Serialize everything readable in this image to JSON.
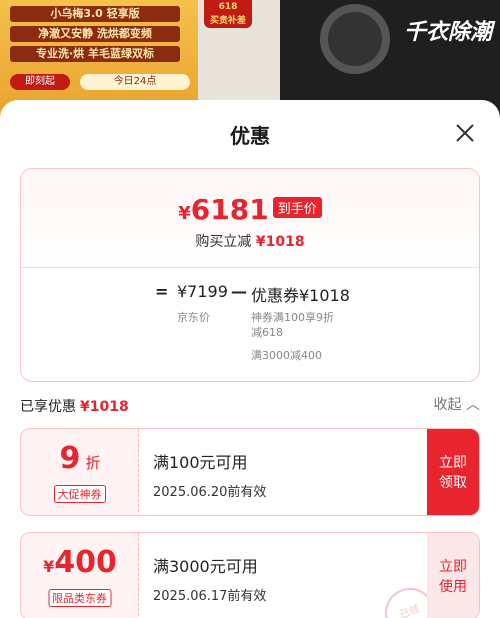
{
  "banner": {
    "lines": [
      "小乌梅3.0 轻享版",
      "净澈又安静 洗烘都变频",
      "专业洗·烘 羊毛蓝绿双标"
    ],
    "pill_left": "即刻起",
    "pill_right": "今日24点",
    "mid_tag": [
      "618",
      "买贵补差"
    ],
    "right_text": "千衣除潮"
  },
  "sheet": {
    "title": "优惠"
  },
  "summary": {
    "currency": "¥",
    "final_price": "6181",
    "price_tag": "到手价",
    "save_label": "购买立减",
    "save_amount": "¥1018",
    "eq": "=",
    "jd_price": "¥7199",
    "minus": "—",
    "coupon_total": "优惠券¥1018",
    "jd_price_label": "京东价",
    "coupon_detail_1": "神券满100享9折",
    "coupon_detail_2": "减618",
    "coupon_detail_3": "满3000减400"
  },
  "received": {
    "label": "已享优惠",
    "amount": "¥1018",
    "collapse": "收起 ︿"
  },
  "coupons": [
    {
      "value_main": "9",
      "value_unit": "折",
      "tag": "大促神券",
      "condition": "满100元可用",
      "expiry": "2025.06.20前有效",
      "action_line1": "立即",
      "action_line2": "领取"
    },
    {
      "value_prefix": "¥",
      "value_main": "400",
      "tag": "限品类东券",
      "condition": "满3000元可用",
      "expiry": "2025.06.17前有效",
      "action_line1": "立即",
      "action_line2": "使用",
      "stamp": "已领"
    }
  ],
  "colors": {
    "accent": "#e8242f",
    "accent_light": "#fbe6e8",
    "border": "#f6c4c8"
  }
}
